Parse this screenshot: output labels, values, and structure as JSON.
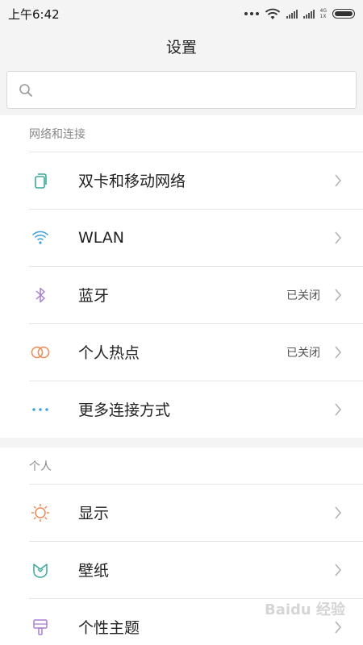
{
  "status_bar": {
    "time": "上午6:42",
    "network_type": "4G",
    "sim_label": "1X"
  },
  "header": {
    "title": "设置"
  },
  "search": {
    "placeholder": ""
  },
  "sections": [
    {
      "title": "网络和连接",
      "items": [
        {
          "label": "双卡和移动网络",
          "value": "",
          "icon": "dual-sim-icon",
          "color": "#3aa89a"
        },
        {
          "label": "WLAN",
          "value": "",
          "icon": "wifi-icon",
          "color": "#3c9fd6"
        },
        {
          "label": "蓝牙",
          "value": "已关闭",
          "icon": "bluetooth-icon",
          "color": "#a77fd6"
        },
        {
          "label": "个人热点",
          "value": "已关闭",
          "icon": "hotspot-icon",
          "color": "#ef8855"
        },
        {
          "label": "更多连接方式",
          "value": "",
          "icon": "more-dots-icon",
          "color": "#3c9fd6"
        }
      ]
    },
    {
      "title": "个人",
      "items": [
        {
          "label": "显示",
          "value": "",
          "icon": "brightness-icon",
          "color": "#ef8855"
        },
        {
          "label": "壁纸",
          "value": "",
          "icon": "wallpaper-icon",
          "color": "#3aa89a"
        },
        {
          "label": "个性主题",
          "value": "",
          "icon": "theme-brush-icon",
          "color": "#a77fd6"
        }
      ]
    }
  ],
  "watermark": {
    "text": "Baidu 经验"
  }
}
